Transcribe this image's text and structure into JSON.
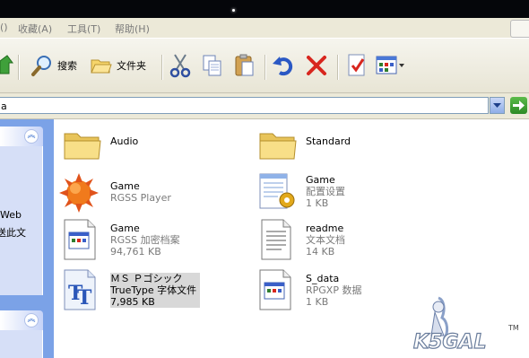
{
  "menu": {
    "items": [
      "()",
      "收藏(A)",
      "工具(T)",
      "帮助(H)"
    ]
  },
  "toolbar": {
    "search_label": "搜索",
    "folders_label": "文件夹"
  },
  "address": {
    "value": "a"
  },
  "leftpane": {
    "lines": [
      "Web",
      "送此文"
    ]
  },
  "files": [
    {
      "name": "Audio",
      "line2": "",
      "line3": "",
      "icon": "folder-icon"
    },
    {
      "name": "Standard",
      "line2": "",
      "line3": "",
      "icon": "folder-icon"
    },
    {
      "name": "Game",
      "line2": "RGSS Player",
      "line3": "",
      "icon": "rgss-player-icon"
    },
    {
      "name": "Game",
      "line2": "配置设置",
      "line3": "1 KB",
      "icon": "config-settings-icon"
    },
    {
      "name": "Game",
      "line2": "RGSS 加密档案",
      "line3": "94,761 KB",
      "icon": "archive-file-icon"
    },
    {
      "name": "readme",
      "line2": "文本文档",
      "line3": "14 KB",
      "icon": "text-document-icon"
    },
    {
      "name": "ＭＳ Ｐゴシック",
      "line2": "TrueType 字体文件",
      "line3": "7,985 KB",
      "icon": "truetype-font-icon"
    },
    {
      "name": "S_data",
      "line2": "RPGXP 数据",
      "line3": "1 KB",
      "icon": "data-file-icon"
    }
  ],
  "watermark": {
    "text": "K5GAL",
    "tm": "TM"
  }
}
